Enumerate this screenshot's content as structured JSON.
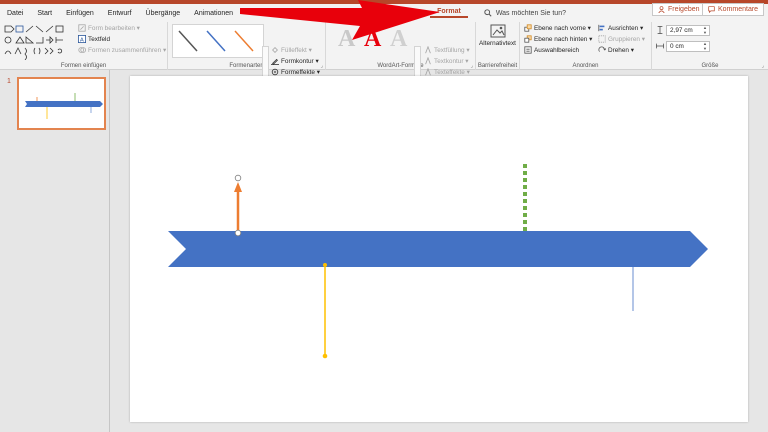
{
  "tabs": [
    {
      "label": "Datei"
    },
    {
      "label": "Start"
    },
    {
      "label": "Einfügen"
    },
    {
      "label": "Entwurf"
    },
    {
      "label": "Übergänge"
    },
    {
      "label": "Animationen"
    },
    {
      "label": "Format",
      "active": true
    }
  ],
  "tellme": {
    "placeholder": "Was möchten Sie tun?"
  },
  "share": {
    "freigeben": "Freigeben",
    "kommentare": "Kommentare"
  },
  "ribbon": {
    "formen_einfuegen": {
      "label": "Formen einfügen",
      "form_bearbeiten": "Form bearbeiten",
      "textfeld": "Textfeld",
      "formen_zusammenfuehren": "Formen zusammenführen"
    },
    "formenarten": {
      "label": "Formenarten",
      "fuelleffekt": "Fülleffekt",
      "formkontur": "Formkontur",
      "formeffekte": "Formeffekte"
    },
    "wordart": {
      "label": "WordArt-Formate",
      "glyph": "A",
      "textfuellung": "Textfüllung",
      "textkontur": "Textkontur",
      "texteffekte": "Texteffekte"
    },
    "barrierefreiheit": {
      "label": "Barrierefreiheit",
      "alternativtext": "Alternativtext"
    },
    "anordnen": {
      "label": "Anordnen",
      "ebene_nach_vorne": "Ebene nach vorne",
      "ebene_nach_hinten": "Ebene nach hinten",
      "auswahlbereich": "Auswahlbereich",
      "ausrichten": "Ausrichten",
      "gruppieren": "Gruppieren",
      "drehen": "Drehen"
    },
    "groesse": {
      "label": "Größe",
      "hoehe": "2,97 cm",
      "breite": "0 cm"
    }
  },
  "slides": {
    "current_number": "1"
  },
  "colors": {
    "accent": "#b7472a",
    "arrow_blue": "#4472c4",
    "orange": "#ed7d31",
    "yellow": "#ffc000",
    "green": "#70ad47",
    "annotation_red": "#e8000b"
  }
}
